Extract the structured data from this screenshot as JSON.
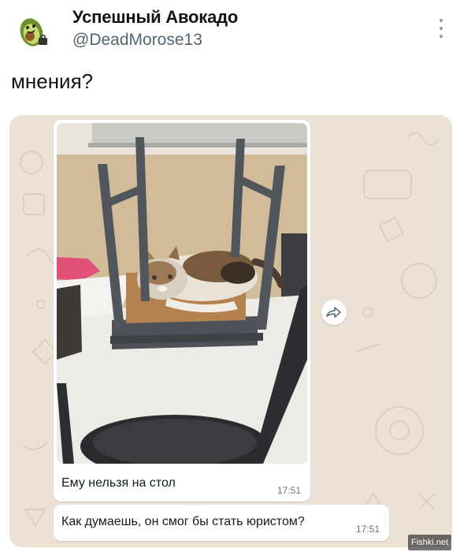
{
  "author": {
    "display_name": "Успешный Авокадо",
    "handle": "@DeadMorose13"
  },
  "tweet": {
    "text": "мнения?"
  },
  "chat": {
    "messages": [
      {
        "type": "photo",
        "caption": "Ему нельзя на стол",
        "time": "17:51"
      },
      {
        "type": "text",
        "text": "Как думаешь, он смог бы стать юристом?",
        "time": "17:51"
      }
    ]
  },
  "watermark": "Fishki.net",
  "icons": [
    "more-options-icon",
    "forward-icon",
    "avatar-icon"
  ],
  "colors": {
    "name": "#0f1419",
    "handle": "#536471",
    "chat_wallpaper": "#ebe1d4",
    "bubble": "#ffffff",
    "time": "#667781"
  }
}
